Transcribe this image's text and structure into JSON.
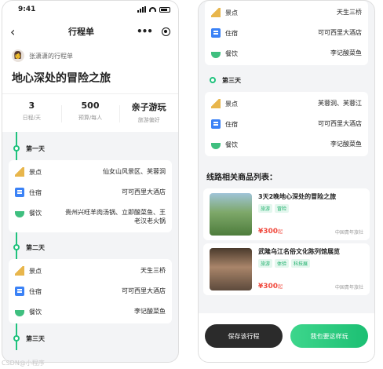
{
  "status_bar": {
    "time": "9:41"
  },
  "nav": {
    "title": "行程单"
  },
  "author": {
    "name": "张潇潇的行程单"
  },
  "trip_title": "地心深处的冒险之旅",
  "stats": [
    {
      "value": "3",
      "label": "日程/天"
    },
    {
      "value": "500",
      "label": "预算/每人"
    },
    {
      "value": "亲子游玩",
      "label": "旅游偏好"
    }
  ],
  "categories": {
    "sight": "景点",
    "hotel": "住宿",
    "food": "餐饮"
  },
  "icons": {
    "sight": "mountain-icon",
    "hotel": "hotel-icon",
    "food": "bowl-icon"
  },
  "days": [
    {
      "label": "第一天",
      "sight": "仙女山风景区、芙蓉洞",
      "hotel": "可可西里大酒店",
      "food": "贵州兴旺羊肉汤锅、立即酸菜鱼、王老汉老火锅"
    },
    {
      "label": "第二天",
      "sight": "天生三桥",
      "hotel": "可可西里大酒店",
      "food": "李记酸菜鱼"
    },
    {
      "label": "第三天",
      "sight": "芙蓉洞、芙蓉江",
      "hotel": "可可西里大酒店",
      "food": "李记酸菜鱼"
    }
  ],
  "products_title": "线路相关商品列表：",
  "products": [
    {
      "name": "3天2晚地心深处的冒险之旅",
      "tags": [
        "旅游",
        "冒险"
      ],
      "price": "¥300",
      "unit": "起",
      "vendor": "中国青年旅社"
    },
    {
      "name": "武隆乌江名俗文化陈列馆展览",
      "tags": [
        "旅游",
        "体验",
        "科技展"
      ],
      "price": "¥300",
      "unit": "起",
      "vendor": "中国青年旅社"
    }
  ],
  "buttons": {
    "save": "保存该行程",
    "follow": "我也要这样玩"
  },
  "watermark": "CSDN@小程序",
  "colors": {
    "accent": "#1fc27d",
    "price": "#f04a3e",
    "dark_button": "#2b2b2b"
  }
}
